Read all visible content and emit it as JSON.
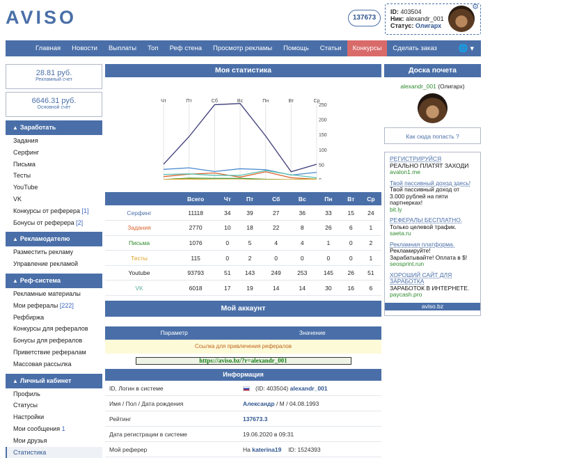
{
  "logo": "AVISO",
  "counter": "137673",
  "user": {
    "id_label": "ID:",
    "id": "403504",
    "nick_label": "Ник:",
    "nick": "alexandr_001",
    "status_label": "Статус:",
    "status": "Олигарх"
  },
  "nav": [
    "Главная",
    "Новости",
    "Выплаты",
    "Топ",
    "Реф стена",
    "Просмотр рекламы",
    "Помощь",
    "Статьи",
    "Конкурсы",
    "Сделать заказ"
  ],
  "balance": [
    {
      "value": "28.81 руб.",
      "label": "Рекламный счет"
    },
    {
      "value": "6646.31 руб.",
      "label": "Основной счет"
    }
  ],
  "sections": [
    {
      "title": "Заработать",
      "items": [
        {
          "t": "Задания"
        },
        {
          "t": "Серфинг"
        },
        {
          "t": "Письма"
        },
        {
          "t": "Тесты"
        },
        {
          "t": "YouTube"
        },
        {
          "t": "VK"
        },
        {
          "t": "Конкурсы от реферера",
          "c": "[1]"
        },
        {
          "t": "Бонусы от реферера",
          "c": "[2]"
        }
      ]
    },
    {
      "title": "Рекламодателю",
      "items": [
        {
          "t": "Разместить рекламу"
        },
        {
          "t": "Управление рекламой"
        }
      ]
    },
    {
      "title": "Реф-система",
      "items": [
        {
          "t": "Рекламные материалы"
        },
        {
          "t": "Мои рефералы",
          "c": "[222]"
        },
        {
          "t": "Рефбиржа"
        },
        {
          "t": "Конкурсы для рефералов"
        },
        {
          "t": "Бонусы для рефералов"
        },
        {
          "t": "Приветствие рефералам"
        },
        {
          "t": "Массовая рассылка"
        }
      ]
    },
    {
      "title": "Личный кабинет",
      "items": [
        {
          "t": "Профиль"
        },
        {
          "t": "Статусы"
        },
        {
          "t": "Настройки"
        },
        {
          "t": "Мои сообщения",
          "c": "1"
        },
        {
          "t": "Мои друзья"
        },
        {
          "t": "Статистика"
        }
      ]
    }
  ],
  "stats_title": "Моя статистика",
  "chart_data": {
    "type": "line",
    "categories": [
      "Чт",
      "Пт",
      "Сб",
      "Вс",
      "Пн",
      "Вт",
      "Ср"
    ],
    "ylim": [
      0,
      250
    ],
    "yticks": [
      "250",
      "200",
      "150",
      "100",
      "50",
      "0"
    ],
    "series": [
      {
        "name": "Youtube",
        "color": "#3b3a78",
        "values": [
          51,
          143,
          249,
          253,
          145,
          26,
          51
        ]
      },
      {
        "name": "Серфинг",
        "color": "#4a8ad0",
        "values": [
          34,
          39,
          27,
          36,
          33,
          15,
          24
        ]
      },
      {
        "name": "Задания",
        "color": "#d9622c",
        "values": [
          10,
          18,
          22,
          8,
          26,
          6,
          1
        ]
      },
      {
        "name": "VK",
        "color": "#5bc0b0",
        "values": [
          17,
          19,
          14,
          14,
          30,
          16,
          6
        ]
      },
      {
        "name": "Письма",
        "color": "#3a9a3a",
        "values": [
          0,
          5,
          4,
          4,
          1,
          0,
          2
        ]
      },
      {
        "name": "Тесты",
        "color": "#e0a020",
        "values": [
          0,
          2,
          0,
          0,
          0,
          0,
          1
        ]
      }
    ]
  },
  "table": {
    "headers": [
      "",
      "Всего",
      "Чт",
      "Пт",
      "Сб",
      "Вс",
      "Пн",
      "Вт",
      "Ср"
    ],
    "rows": [
      {
        "label": "Серфинг",
        "color": "#4a6fa8",
        "cells": [
          "11118",
          "34",
          "39",
          "27",
          "36",
          "33",
          "15",
          "24"
        ]
      },
      {
        "label": "Задания",
        "color": "#d9622c",
        "cells": [
          "2770",
          "10",
          "18",
          "22",
          "8",
          "26",
          "6",
          "1"
        ]
      },
      {
        "label": "Письма",
        "color": "#2d8a2d",
        "cells": [
          "1076",
          "0",
          "5",
          "4",
          "4",
          "1",
          "0",
          "2"
        ]
      },
      {
        "label": "Тесты",
        "color": "#e0a020",
        "cells": [
          "115",
          "0",
          "2",
          "0",
          "0",
          "0",
          "0",
          "1"
        ]
      },
      {
        "label": "Youtube",
        "color": "#222222",
        "cells": [
          "93793",
          "51",
          "143",
          "249",
          "253",
          "145",
          "26",
          "51"
        ]
      },
      {
        "label": "VK",
        "color": "#5bb0a0",
        "cells": [
          "6018",
          "17",
          "19",
          "14",
          "14",
          "30",
          "16",
          "6"
        ]
      }
    ]
  },
  "account_title": "Мой аккаунт",
  "params": {
    "col1": "Параметр",
    "col2": "Значение",
    "ref_label": "Ссылка для привлечения рефералов",
    "ref_link": "https://aviso.bz/?r=alexandr_001"
  },
  "info": {
    "title": "Информация",
    "rows": [
      {
        "k": "ID, Логин в системе",
        "pre": "(ID: 403504)",
        "b": "alexandr_001",
        "post": ""
      },
      {
        "k": "Имя / Пол / Дата рождения",
        "pre": "",
        "b": "Александр",
        "post": " / М / 04.08.1993"
      },
      {
        "k": "Рейтинг",
        "pre": "",
        "b": "137673.3",
        "post": ""
      },
      {
        "k": "Дата регистрации в системе",
        "pre": "19.06.2020 в 09:31",
        "b": "",
        "post": ""
      },
      {
        "k": "Мой реферер",
        "pre": "На",
        "b": "katerina19",
        "post": "ID: 1524393"
      }
    ]
  },
  "fame": {
    "title": "Доска почета",
    "name": "alexandr_001",
    "status": "(Олигарх)",
    "q": "Как сюда попасть ?"
  },
  "ads": [
    {
      "t": "РЕГИСТРИРУЙСЯ",
      "x": "РЕАЛЬНО ПЛАТЯТ ЗАХОДИ",
      "u": "avalon1.me"
    },
    {
      "t": "Твой пассивный доход здесь!",
      "x": "Твой пассивный доход от 3.000 рублей на пяти партнерках!",
      "u": "bit.ly"
    },
    {
      "t": "РЕФЕРАЛЫ БЕСПЛАТНО.",
      "x": "Только целевой трафик.",
      "u": "saeta.ru"
    },
    {
      "t": "Рекламная платформа.",
      "x": "Рекламируйте! Зарабатывайте! Оплата в $!",
      "u": "seosprint.run"
    },
    {
      "t": "ХОРОШИЙ САЙТ ДЛЯ ЗАРАБОТКА",
      "x": "ЗАРАБОТОК В ИНТЕРНЕТЕ.",
      "u": "paycash.pro"
    }
  ],
  "ads_footer": "aviso.bz"
}
